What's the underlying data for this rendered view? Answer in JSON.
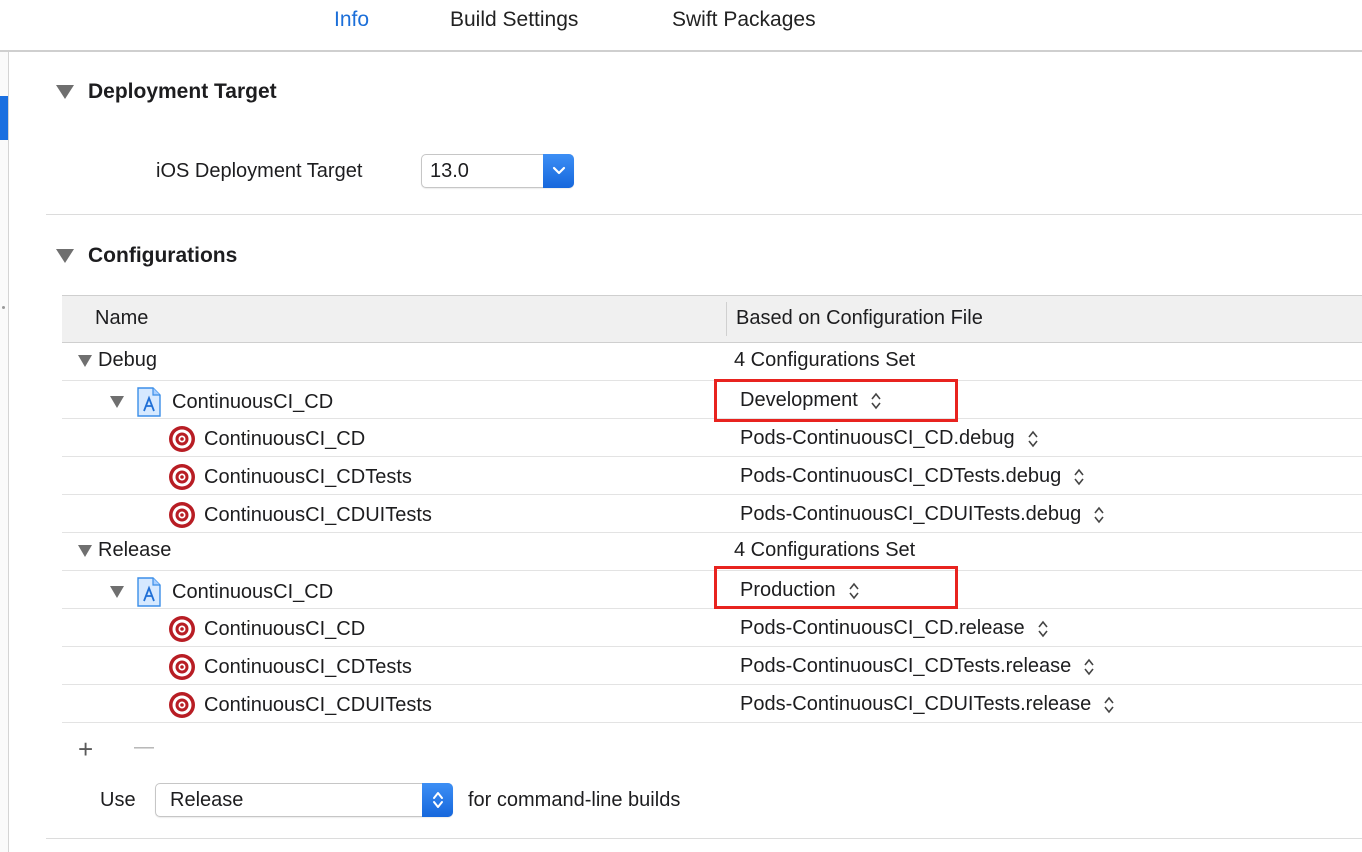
{
  "tabs": [
    {
      "label": "Info",
      "active": true
    },
    {
      "label": "Build Settings",
      "active": false
    },
    {
      "label": "Swift Packages",
      "active": false
    }
  ],
  "deployment": {
    "title": "Deployment Target",
    "label": "iOS Deployment Target",
    "value": "13.0"
  },
  "configurations": {
    "title": "Configurations",
    "columns": [
      "Name",
      "Based on Configuration File"
    ],
    "rows": [
      {
        "name": "Debug",
        "file": "4 Configurations Set"
      },
      {
        "name": "ContinuousCI_CD",
        "file": "Development"
      },
      {
        "name": "ContinuousCI_CD",
        "file": "Pods-ContinuousCI_CD.debug"
      },
      {
        "name": "ContinuousCI_CDTests",
        "file": "Pods-ContinuousCI_CDTests.debug"
      },
      {
        "name": "ContinuousCI_CDUITests",
        "file": "Pods-ContinuousCI_CDUITests.debug"
      },
      {
        "name": "Release",
        "file": "4 Configurations Set"
      },
      {
        "name": "ContinuousCI_CD",
        "file": "Production"
      },
      {
        "name": "ContinuousCI_CD",
        "file": "Pods-ContinuousCI_CD.release"
      },
      {
        "name": "ContinuousCI_CDTests",
        "file": "Pods-ContinuousCI_CDTests.release"
      },
      {
        "name": "ContinuousCI_CDUITests",
        "file": "Pods-ContinuousCI_CDUITests.release"
      }
    ],
    "add_symbol": "+",
    "remove_symbol": "—"
  },
  "command_line": {
    "use_label": "Use",
    "value": "Release",
    "suffix": "for command-line builds"
  },
  "colors": {
    "accent": "#1c6fd9",
    "highlight": "#e8231f",
    "target_icon": "#b81d24",
    "project_icon": "#3b8ee8"
  }
}
